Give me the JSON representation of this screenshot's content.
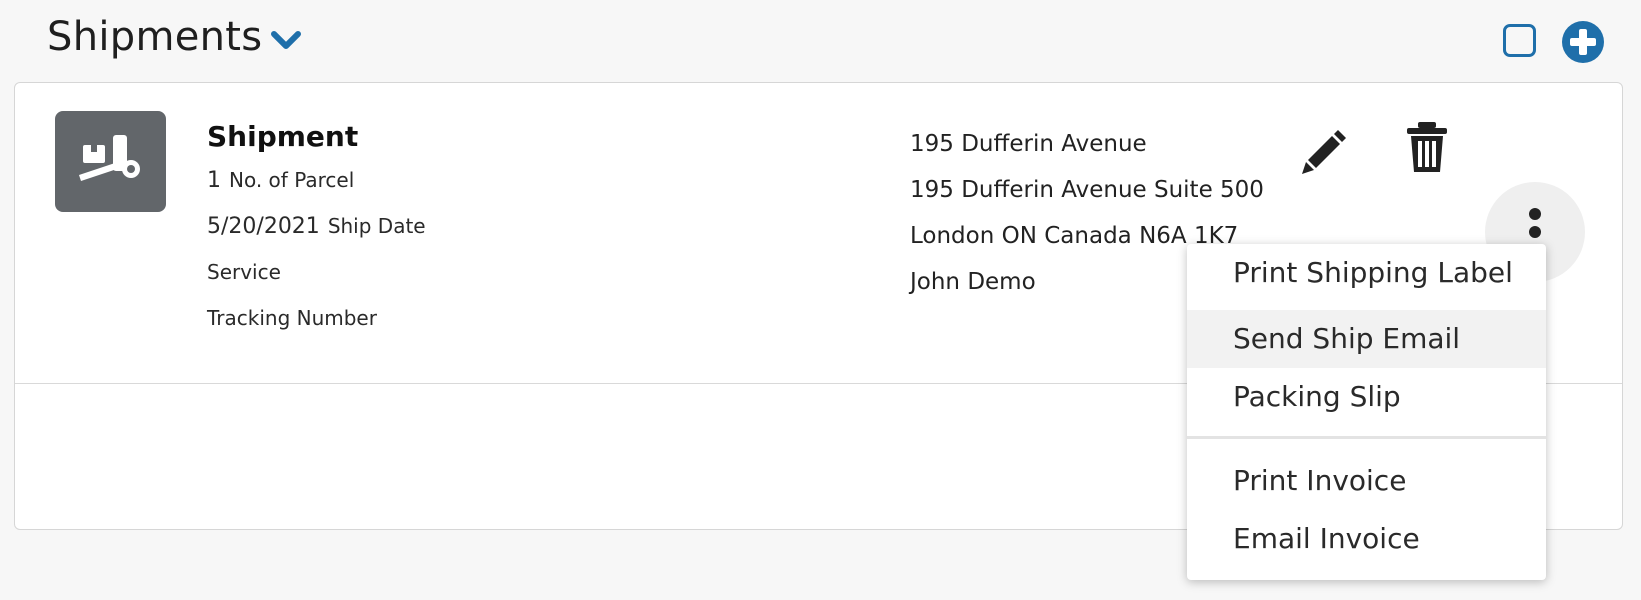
{
  "header": {
    "title": "Shipments",
    "accent_color": "#1f6faa",
    "title_menu_icon": "chevron-down-icon",
    "select_icon": "checkbox-icon",
    "add_icon": "plus-circle-icon"
  },
  "shipment": {
    "icon": "dolly-icon",
    "title": "Shipment",
    "parcel_count": "1",
    "parcel_label": "No. of Parcel",
    "ship_date": "5/20/2021",
    "ship_date_label": "Ship Date",
    "service_label": "Service",
    "tracking_label": "Tracking Number",
    "address": {
      "line1": "195 Dufferin Avenue",
      "line2": "195 Dufferin Avenue Suite 500",
      "line3": "London ON Canada N6A 1K7",
      "contact": "John Demo"
    }
  },
  "actions": {
    "edit_icon": "pencil-icon",
    "delete_icon": "trash-icon",
    "more_icon": "more-vertical-icon"
  },
  "menu": {
    "items": [
      {
        "label": "Print Shipping Label"
      },
      {
        "label": "Send Ship Email"
      },
      {
        "label": "Packing Slip"
      },
      {
        "label": "Print Invoice"
      },
      {
        "label": "Email Invoice"
      }
    ]
  }
}
